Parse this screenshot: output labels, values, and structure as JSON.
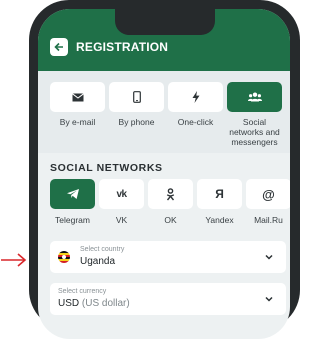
{
  "header": {
    "title": "REGISTRATION"
  },
  "reg_methods": [
    {
      "icon": "envelope-icon",
      "label": "By e-mail",
      "active": false
    },
    {
      "icon": "phone-icon",
      "label": "By phone",
      "active": false
    },
    {
      "icon": "lightning-icon",
      "label": "One-click",
      "active": false
    },
    {
      "icon": "users-icon",
      "label": "Social networks and messengers",
      "active": true
    }
  ],
  "social_title": "SOCIAL NETWORKS",
  "socials": [
    {
      "icon": "telegram-icon",
      "glyph": "",
      "label": "Telegram",
      "active": true
    },
    {
      "icon": "vk-icon",
      "glyph": "vk",
      "label": "VK",
      "active": false
    },
    {
      "icon": "ok-icon",
      "glyph": "",
      "label": "OK",
      "active": false
    },
    {
      "icon": "yandex-icon",
      "glyph": "Я",
      "label": "Yandex",
      "active": false
    },
    {
      "icon": "mailru-icon",
      "glyph": "@",
      "label": "Mail.Ru",
      "active": false
    }
  ],
  "country_field": {
    "label": "Select country",
    "value": "Uganda"
  },
  "currency_field": {
    "label": "Select currency",
    "code": "USD",
    "name": "(US dollar)"
  },
  "colors": {
    "brand_green": "#1f7048",
    "arrow_red": "#d9262a"
  }
}
